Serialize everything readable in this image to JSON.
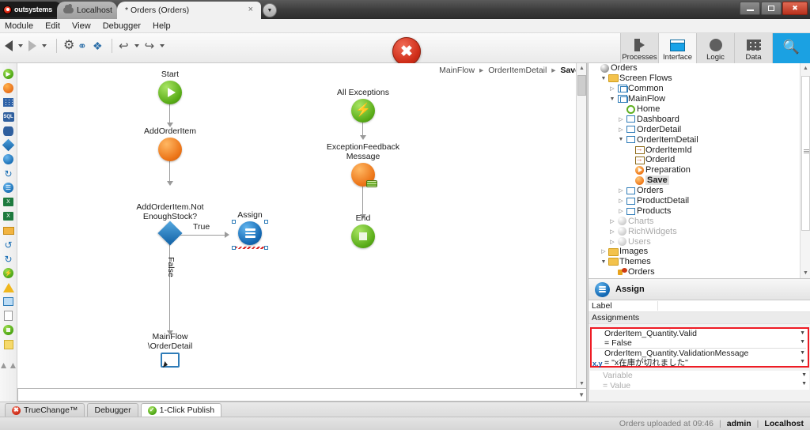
{
  "window": {
    "logo_text": "outsystems",
    "env_tab": "Localhost",
    "doc_tab": "* Orders (Orders)",
    "close_x": "×",
    "minimize_label": "Minimize",
    "maximize_label": "Maximize",
    "close_label": "Close"
  },
  "menu": {
    "items": [
      "Module",
      "Edit",
      "View",
      "Debugger",
      "Help"
    ]
  },
  "toolbar": {
    "back_label": "Back",
    "forward_label": "Forward",
    "settings_label": "Settings",
    "merge_label": "Merge",
    "compare_label": "Compare",
    "undo_label": "Undo",
    "redo_label": "Redo",
    "error_badge": "✖",
    "sections": [
      {
        "label": "Processes",
        "icon": "processes-icon",
        "active": false
      },
      {
        "label": "Interface",
        "icon": "interface-icon",
        "active": true
      },
      {
        "label": "Logic",
        "icon": "logic-icon",
        "active": false
      },
      {
        "label": "Data",
        "icon": "data-icon",
        "active": false
      }
    ],
    "search_icon": "🔍"
  },
  "left_toolbox": {
    "items": [
      "start-icon",
      "action-icon",
      "grid-icon",
      "sql-icon",
      "database-icon",
      "if-icon",
      "switch-icon",
      "cycle-icon",
      "assign-icon",
      "excel-export-icon",
      "excel-import-icon",
      "email-icon",
      "refresh-icon",
      "ajax-refresh-icon",
      "exception-handler-icon",
      "raise-exception-icon",
      "destination-icon",
      "run-server-action-icon",
      "end-icon",
      "comment-icon",
      "collapse-icon"
    ]
  },
  "canvas": {
    "breadcrumb": {
      "parts": [
        "MainFlow",
        "OrderItemDetail",
        "Save"
      ],
      "separator": "▸"
    },
    "nodes": [
      {
        "id": "start",
        "label": "Start",
        "type": "start"
      },
      {
        "id": "addorderitem",
        "label": "AddOrderItem",
        "type": "action"
      },
      {
        "id": "ifnotenough",
        "label": "AddOrderItem.Not\nEnoughStock?",
        "type": "if"
      },
      {
        "id": "assign",
        "label": "Assign",
        "type": "assign",
        "selected": true
      },
      {
        "id": "destination",
        "label": "MainFlow\n\\OrderDetail",
        "type": "destination"
      },
      {
        "id": "allexceptions",
        "label": "All Exceptions",
        "type": "exception-handler"
      },
      {
        "id": "feedback",
        "label": "ExceptionFeedback\nMessage",
        "type": "action-feedback"
      },
      {
        "id": "end",
        "label": "End",
        "type": "end"
      }
    ],
    "connector_labels": {
      "true": "True",
      "false": "False"
    }
  },
  "tree": {
    "root": "Orders",
    "nodes": [
      {
        "label": "Orders",
        "indent": 0,
        "icon": "module-sphere-icon",
        "twisty": "",
        "state": "normal"
      },
      {
        "label": "Screen Flows",
        "indent": 1,
        "icon": "folder-icon",
        "twisty": "open",
        "state": "normal"
      },
      {
        "label": "Common",
        "indent": 2,
        "icon": "flow-icon",
        "twisty": "closed",
        "state": "normal"
      },
      {
        "label": "MainFlow",
        "indent": 2,
        "icon": "flow-icon",
        "twisty": "open",
        "state": "normal"
      },
      {
        "label": "Home",
        "indent": 3,
        "icon": "home-screen-icon",
        "twisty": "",
        "state": "normal"
      },
      {
        "label": "Dashboard",
        "indent": 3,
        "icon": "screen-icon",
        "twisty": "closed",
        "state": "normal"
      },
      {
        "label": "OrderDetail",
        "indent": 3,
        "icon": "screen-icon",
        "twisty": "closed",
        "state": "normal"
      },
      {
        "label": "OrderItemDetail",
        "indent": 3,
        "icon": "screen-icon",
        "twisty": "open",
        "state": "normal"
      },
      {
        "label": "OrderItemId",
        "indent": 4,
        "icon": "input-parameter-icon",
        "twisty": "",
        "state": "normal"
      },
      {
        "label": "OrderId",
        "indent": 4,
        "icon": "input-parameter-icon",
        "twisty": "",
        "state": "normal"
      },
      {
        "label": "Preparation",
        "indent": 4,
        "icon": "preparation-icon",
        "twisty": "",
        "state": "normal"
      },
      {
        "label": "Save",
        "indent": 4,
        "icon": "screen-action-icon",
        "twisty": "",
        "state": "selected"
      },
      {
        "label": "Orders",
        "indent": 3,
        "icon": "screen-icon",
        "twisty": "closed",
        "state": "normal"
      },
      {
        "label": "ProductDetail",
        "indent": 3,
        "icon": "screen-icon",
        "twisty": "closed",
        "state": "normal"
      },
      {
        "label": "Products",
        "indent": 3,
        "icon": "screen-icon",
        "twisty": "closed",
        "state": "normal"
      },
      {
        "label": "Charts",
        "indent": 2,
        "icon": "module-sphere-icon",
        "twisty": "closed",
        "state": "dim"
      },
      {
        "label": "RichWidgets",
        "indent": 2,
        "icon": "module-sphere-icon",
        "twisty": "closed",
        "state": "dim"
      },
      {
        "label": "Users",
        "indent": 2,
        "icon": "module-sphere-icon",
        "twisty": "closed",
        "state": "dim"
      },
      {
        "label": "Images",
        "indent": 1,
        "icon": "folder-icon",
        "twisty": "closed",
        "state": "normal"
      },
      {
        "label": "Themes",
        "indent": 1,
        "icon": "folder-icon",
        "twisty": "open",
        "state": "normal"
      },
      {
        "label": "Orders",
        "indent": 2,
        "icon": "theme-icon",
        "twisty": "",
        "state": "normal"
      }
    ]
  },
  "properties": {
    "title": "Assign",
    "icon": "assign-icon",
    "rows": [
      {
        "key": "Label",
        "value": ""
      },
      {
        "key": "Assignments",
        "value": "",
        "section": true
      }
    ],
    "assignments": [
      {
        "variable": "OrderItem_Quantity.Valid",
        "eq": "=",
        "value": "False",
        "expr_badge": ""
      },
      {
        "variable": "OrderItem_Quantity.ValidationMessage",
        "eq": "=",
        "value": "\"x在庫が切れました\"",
        "expr_badge": "x.y"
      }
    ],
    "empty_row": {
      "variable": "Variable",
      "eq": "=",
      "value": "Value"
    },
    "highlight_color": "#ee1b24"
  },
  "bottom_tabs": [
    {
      "label": "TrueChange™",
      "icon": "error-icon",
      "active": false
    },
    {
      "label": "Debugger",
      "icon": "",
      "active": false
    },
    {
      "label": "1-Click Publish",
      "icon": "ok-icon",
      "active": true
    }
  ],
  "status": {
    "message": "Orders uploaded at 09:46",
    "separator": "|",
    "user": "admin",
    "environment": "Localhost"
  }
}
